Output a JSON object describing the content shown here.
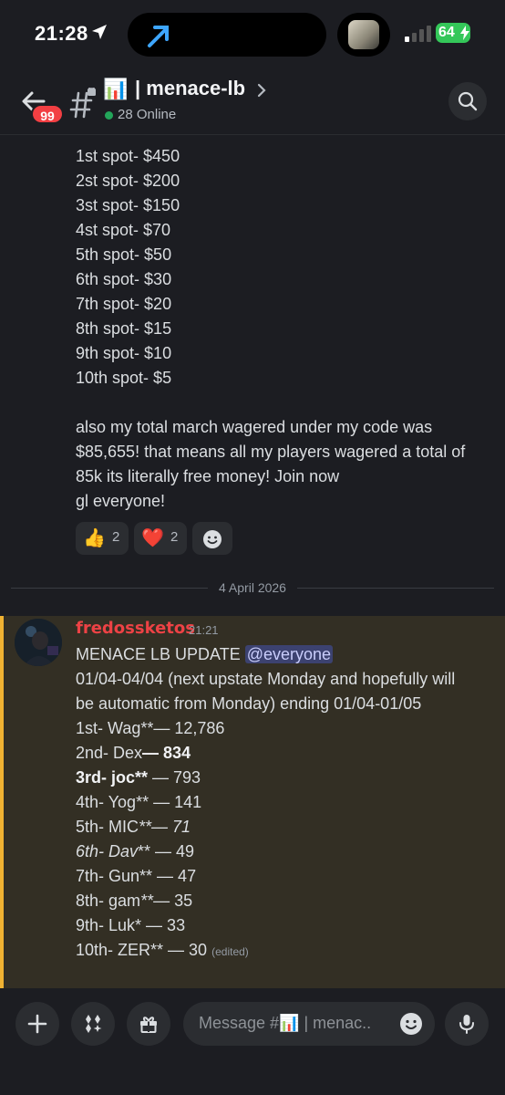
{
  "status_bar": {
    "time": "21:28",
    "battery": "64"
  },
  "header": {
    "back_badge": "99",
    "channel_emoji": "📊",
    "channel_name": "| menace-lb",
    "online_count": "28 Online"
  },
  "message1": {
    "prize_lines": [
      "1st spot- $450",
      "2st spot- $200",
      "3st spot- $150",
      "4st spot- $70",
      "5th spot- $50",
      "6th spot- $30",
      "7th spot- $20",
      "8th spot- $15",
      "9th spot- $10",
      "10th spot- $5"
    ],
    "paragraph": "also my total march wagered under my code was $85,655! that means all my players wagered a total of 85k its literally free money! Join now",
    "signoff": "gl everyone!",
    "reactions": [
      {
        "emoji": "👍",
        "count": "2"
      },
      {
        "emoji": "❤️",
        "count": "2"
      }
    ]
  },
  "date_divider": "4 April 2026",
  "message2": {
    "author": "fredossketos",
    "time": "21:21",
    "title": "MENACE LB UPDATE ",
    "mention": "@everyone",
    "body": "01/04-04/04 (next upstate Monday and hopefully will be automatic from Monday)  ending 01/04-01/05",
    "ranks": [
      {
        "pre": "1st- Wag",
        "mid": "**— 12,786"
      },
      {
        "pre": "2nd- Dex",
        "bold": "— 834"
      },
      {
        "bold": "3rd- joc**",
        "post": " — 793"
      },
      {
        "pre": "4th- Yog",
        "mid": "** — 141"
      },
      {
        "pre": "5th- MIC",
        "italic": "**— 71"
      },
      {
        "italic": "6th- Dav",
        "post": "** — 49"
      },
      {
        "pre": "7th- Gun",
        "mid": "** — 47"
      },
      {
        "pre": "8th- gam",
        "italic": "**",
        "post": "— 35"
      },
      {
        "pre": "9th- Luk",
        "post": "* — 33"
      },
      {
        "pre": "10th- ZER",
        "mid": "** — 30"
      }
    ],
    "edited": "(edited)"
  },
  "composer": {
    "placeholder": "Message #📊 | menac.."
  },
  "colors": {
    "background": "#1c1d22",
    "highlight_bg": "#332f24",
    "highlight_bar": "#f0b232",
    "author": "#ed4245",
    "online": "#23a55a",
    "badge": "#f23f43",
    "mention_bg": "#3c4270"
  },
  "icons": [
    "location-arrow-icon",
    "share-arrow-icon",
    "signal-icon",
    "battery-icon",
    "back-arrow-icon",
    "locked-hash-icon",
    "chevron-right-icon",
    "search-icon",
    "add-reaction-icon",
    "plus-icon",
    "apps-icon",
    "gift-icon",
    "emoji-icon",
    "mic-icon"
  ]
}
